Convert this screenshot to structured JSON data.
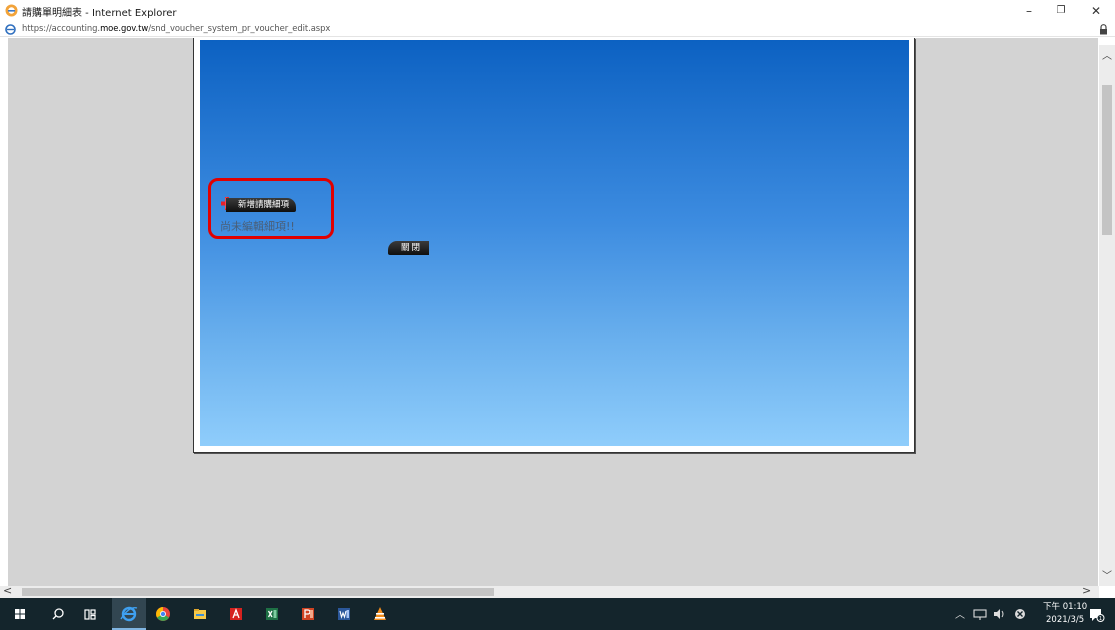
{
  "window": {
    "title": "請購單明細表 - Internet Explorer",
    "url_prefix": "https://accounting.",
    "url_domain": "moe.gov.tw",
    "url_path": "/snd_voucher_system_pr_voucher_edit.aspx"
  },
  "dialog": {
    "add_button_label": "新增請購細項",
    "empty_message": "尚未編輯細項!!",
    "close_button_label": "關閉"
  },
  "taskbar": {
    "items": [
      "start-icon",
      "search-icon",
      "task-view-icon",
      "ie-icon",
      "chrome-icon",
      "file-explorer-icon",
      "acrobat-icon",
      "excel-icon",
      "powerpoint-icon",
      "word-icon",
      "vlc-icon"
    ],
    "clock_time": "下午 01:10",
    "clock_date": "2021/3/5",
    "notification_count": "1"
  },
  "colors": {
    "highlight": "#e10000",
    "dialog_gradient_top": "#0c61c2",
    "dialog_gradient_bottom": "#8fcdfb",
    "taskbar": "#14252c"
  }
}
